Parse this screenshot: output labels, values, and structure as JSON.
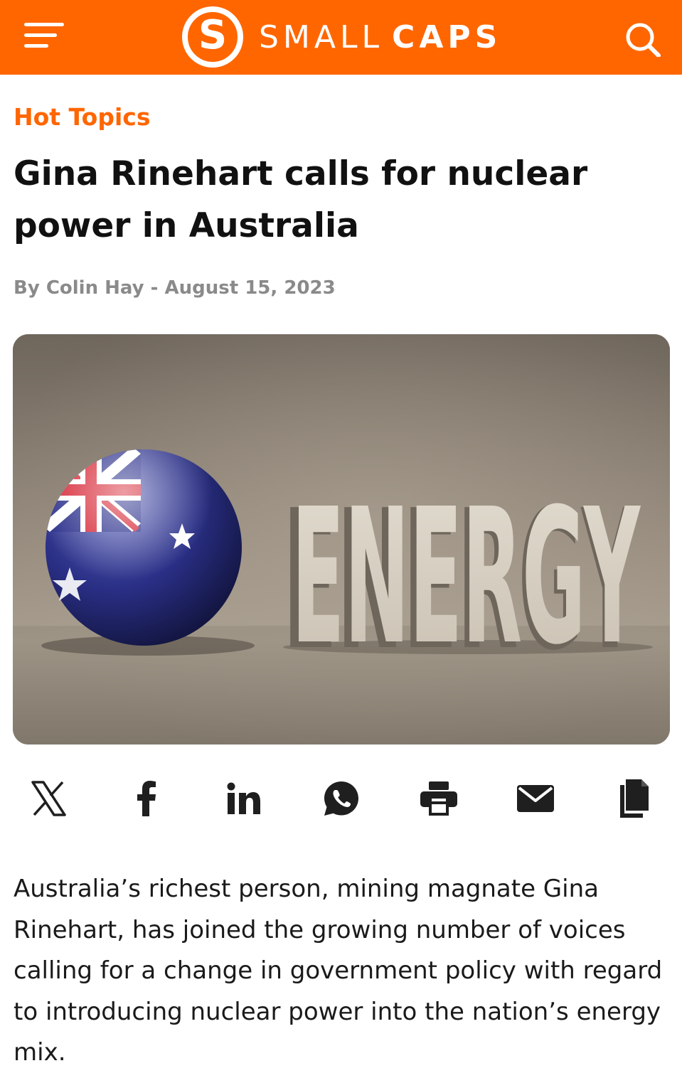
{
  "header": {
    "brand_mark": "S",
    "brand_word_light": "SMALL",
    "brand_word_bold": "CAPS",
    "menu_icon": "hamburger-menu-icon",
    "search_icon": "search-icon",
    "background_color": "#ff6600"
  },
  "article": {
    "category": "Hot Topics",
    "headline": "Gina Rinehart calls for nuclear power in Australia",
    "byline": "By Colin Hay - August 15, 2023",
    "hero_image": {
      "sign_text": "ENERGY",
      "flag_sphere": "australian-flag-sphere"
    },
    "share_icons": [
      "x-icon",
      "facebook-icon",
      "linkedin-icon",
      "whatsapp-icon",
      "print-icon",
      "email-icon",
      "copy-icon"
    ],
    "lede": "Australia’s richest person, mining magnate Gina Rinehart, has joined the growing number of voices calling for a change in government policy with regard to introducing nuclear power into the nation’s energy mix."
  },
  "colors": {
    "accent": "#ff6600",
    "headline": "#111111",
    "byline": "#8a8a8a",
    "icon": "#1f1f1f"
  }
}
